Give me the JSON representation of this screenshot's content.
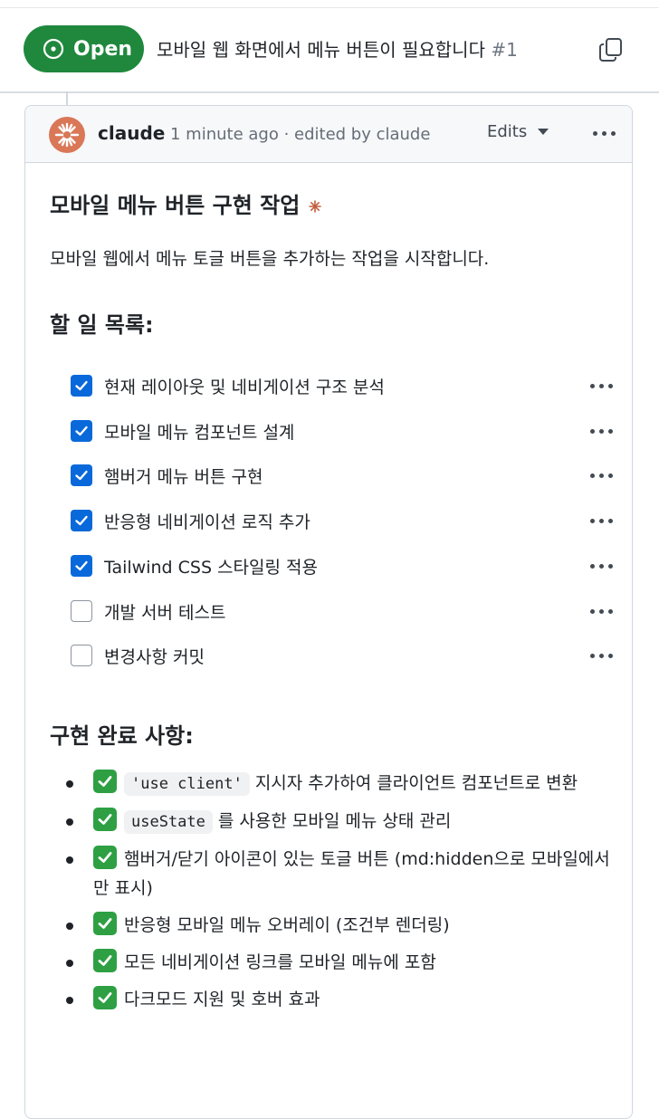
{
  "issue": {
    "status": "Open",
    "title": "모바일 웹 화면에서 메뉴 버튼이 필요합니다",
    "number": "#1",
    "status_color": "#1f883d"
  },
  "comment": {
    "author": "claude",
    "meta": "1 minute ago · edited by claude",
    "edits_label": "Edits",
    "avatar_color": "#d97757",
    "heading": "모바일 메뉴 버튼 구현 작업",
    "intro": "모바일 웹에서 메뉴 토글 버튼을 추가하는 작업을 시작합니다.",
    "todo_heading": "할 일 목록:",
    "tasks": [
      {
        "label": "현재 레이아웃 및 네비게이션 구조 분석",
        "checked": true
      },
      {
        "label": "모바일 메뉴 컴포넌트 설계",
        "checked": true
      },
      {
        "label": "햄버거 메뉴 버튼 구현",
        "checked": true
      },
      {
        "label": "반응형 네비게이션 로직 추가",
        "checked": true
      },
      {
        "label": "Tailwind CSS 스타일링 적용",
        "checked": true
      },
      {
        "label": "개발 서버 테스트",
        "checked": false
      },
      {
        "label": "변경사항 커밋",
        "checked": false
      }
    ],
    "done_heading": "구현 완료 사항:",
    "done_items": [
      {
        "code": "'use client'",
        "text": "지시자 추가하여 클라이언트 컴포넌트로 변환"
      },
      {
        "code": "useState",
        "text": "를 사용한 모바일 메뉴 상태 관리"
      },
      {
        "code": "",
        "text": "햄버거/닫기 아이콘이 있는 토글 버튼 (md:hidden으로 모바일에서만 표시)"
      },
      {
        "code": "",
        "text": "반응형 모바일 메뉴 오버레이 (조건부 렌더링)"
      },
      {
        "code": "",
        "text": "모든 네비게이션 링크를 모바일 메뉴에 포함"
      },
      {
        "code": "",
        "text": "다크모드 지원 및 호버 효과"
      }
    ]
  }
}
